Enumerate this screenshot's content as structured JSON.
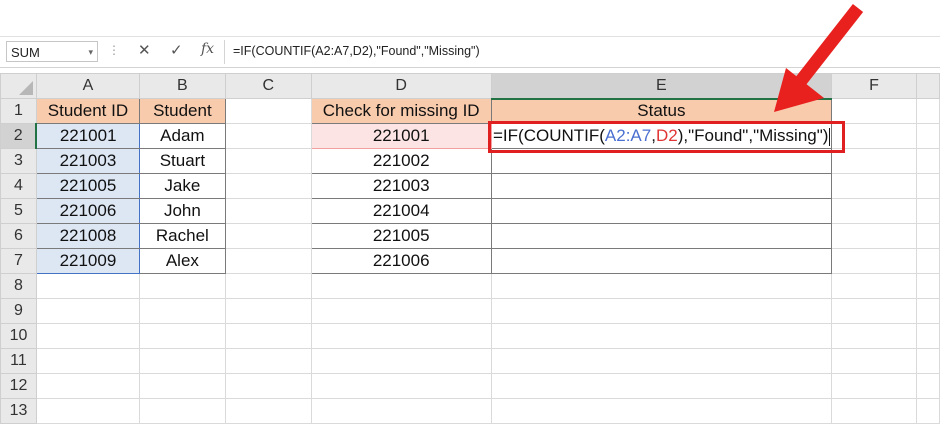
{
  "formula_bar": {
    "name_box": "SUM",
    "name_box_dropdown": "▾",
    "separator_dots": "⋮",
    "cancel_icon": "✕",
    "enter_icon": "✓",
    "fx_label": "fx",
    "formula": "=IF(COUNTIF(A2:A7,D2),\"Found\",\"Missing\")"
  },
  "columns": [
    "A",
    "B",
    "C",
    "D",
    "E",
    "F"
  ],
  "rows": [
    "1",
    "2",
    "3",
    "4",
    "5",
    "6",
    "7",
    "8",
    "9",
    "10",
    "11",
    "12",
    "13"
  ],
  "headers": {
    "a": "Student ID",
    "b": "Student",
    "d": "Check for missing ID",
    "e": "Status"
  },
  "students": [
    {
      "id": "221001",
      "name": "Adam"
    },
    {
      "id": "221003",
      "name": "Stuart"
    },
    {
      "id": "221005",
      "name": "Jake"
    },
    {
      "id": "221006",
      "name": "John"
    },
    {
      "id": "221008",
      "name": "Rachel"
    },
    {
      "id": "221009",
      "name": "Alex"
    }
  ],
  "check_ids": [
    "221001",
    "221002",
    "221003",
    "221004",
    "221005",
    "221006"
  ],
  "editing_cell": {
    "part1": "=IF(COUNTIF(",
    "range_ref": "A2:A7",
    "comma": ",",
    "cell_ref": "D2",
    "part2": "),\"Found\",\"Missing\")"
  },
  "colors": {
    "header_fill": "#f8cbad",
    "highlight_box": "#e02020",
    "arrow": "#e8201e",
    "range_ref": "#4a6fd0",
    "cell_ref": "#e03535",
    "active_accent": "#217346"
  }
}
